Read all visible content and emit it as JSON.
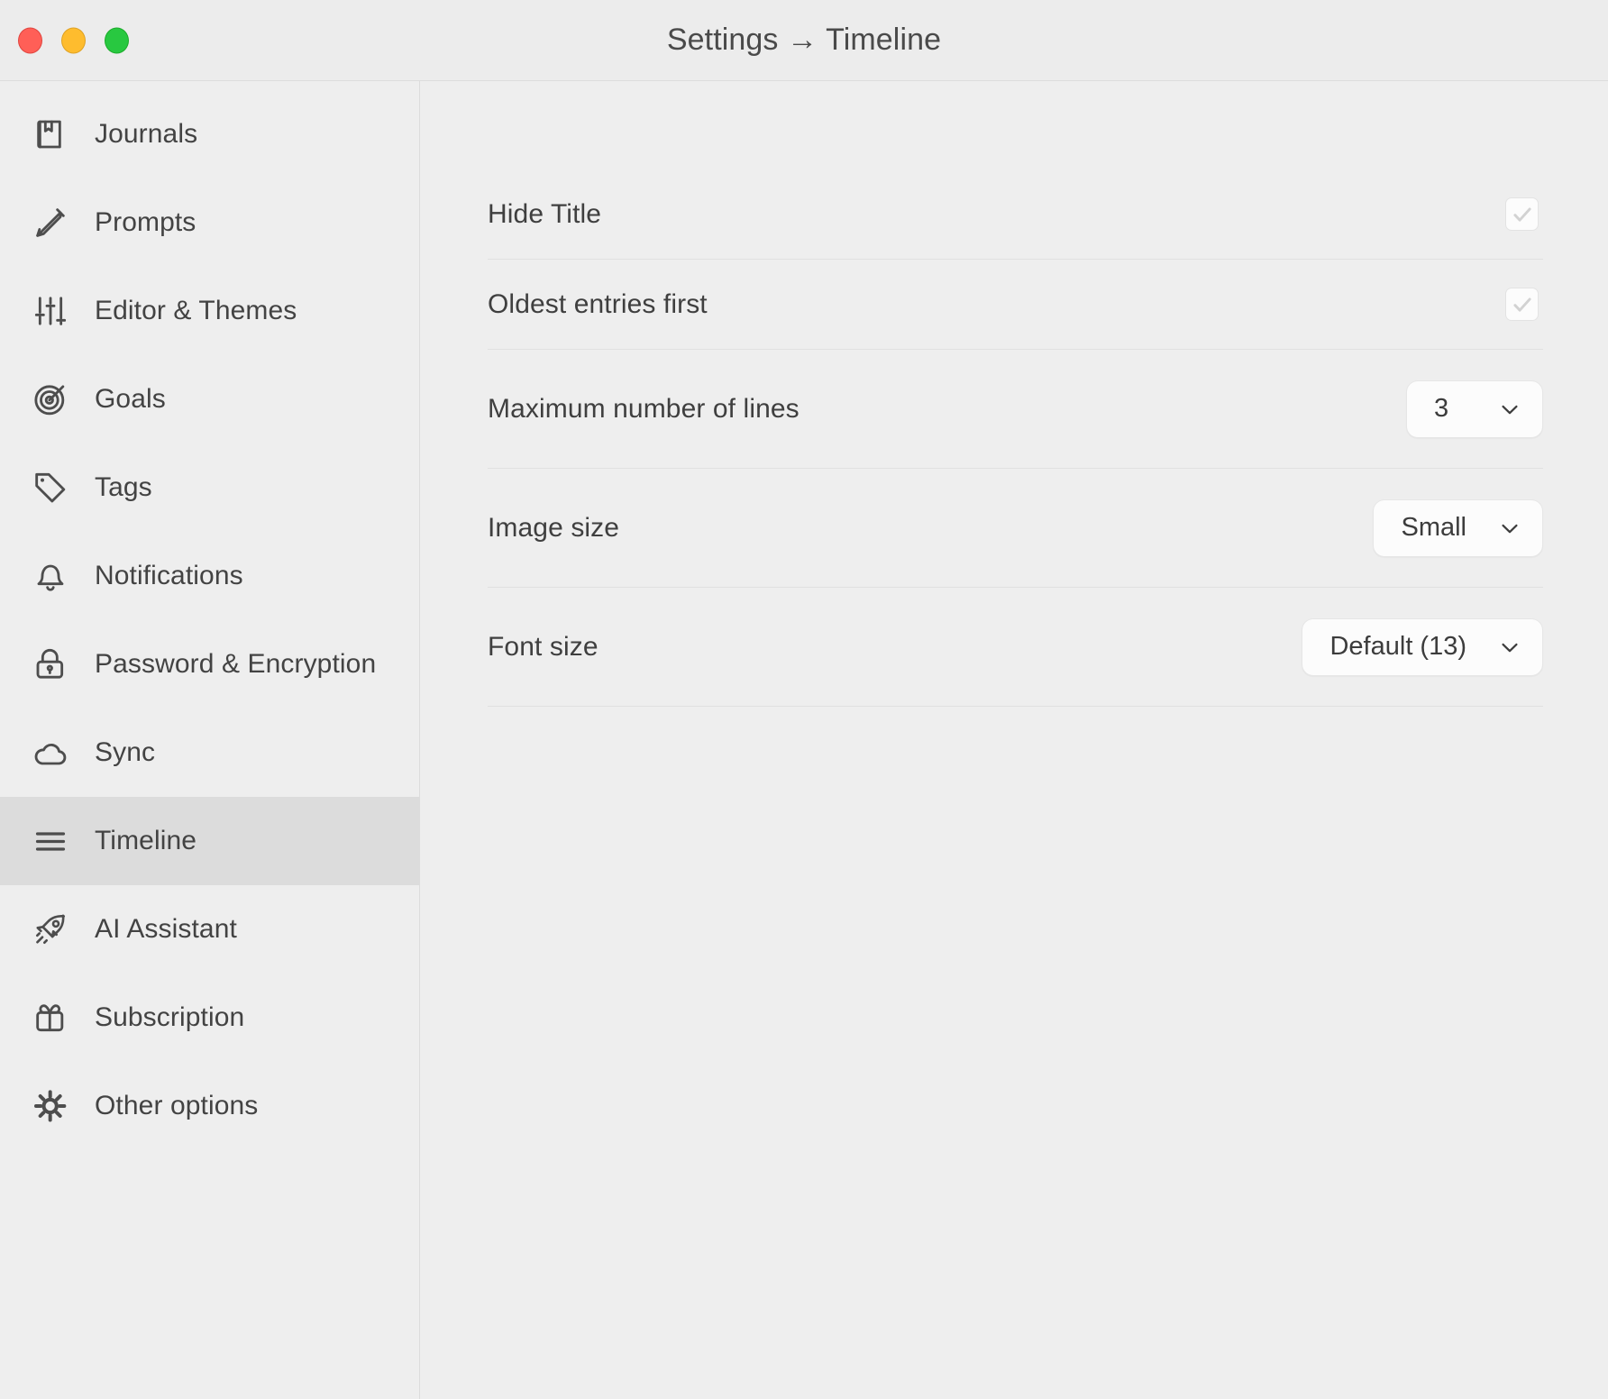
{
  "window": {
    "title": "Settings → Timeline",
    "traffic_lights": {
      "close": "close",
      "minimize": "minimize",
      "maximize": "maximize"
    }
  },
  "sidebar": {
    "items": [
      {
        "label": "Journals",
        "icon": "book-icon",
        "selected": false
      },
      {
        "label": "Prompts",
        "icon": "pencil-icon",
        "selected": false
      },
      {
        "label": "Editor & Themes",
        "icon": "sliders-icon",
        "selected": false
      },
      {
        "label": "Goals",
        "icon": "target-icon",
        "selected": false
      },
      {
        "label": "Tags",
        "icon": "tag-icon",
        "selected": false
      },
      {
        "label": "Notifications",
        "icon": "bell-icon",
        "selected": false
      },
      {
        "label": "Password & Encryption",
        "icon": "lock-icon",
        "selected": false
      },
      {
        "label": "Sync",
        "icon": "cloud-icon",
        "selected": false
      },
      {
        "label": "Timeline",
        "icon": "hamburger-icon",
        "selected": true
      },
      {
        "label": "AI Assistant",
        "icon": "rocket-icon",
        "selected": false
      },
      {
        "label": "Subscription",
        "icon": "gift-icon",
        "selected": false
      },
      {
        "label": "Other options",
        "icon": "gear-icon",
        "selected": false
      }
    ]
  },
  "main": {
    "settings": [
      {
        "label": "Hide Title",
        "control": "checkbox",
        "checked": true
      },
      {
        "label": "Oldest entries first",
        "control": "checkbox",
        "checked": true
      },
      {
        "label": "Maximum number of lines",
        "control": "dropdown",
        "value": "3"
      },
      {
        "label": "Image size",
        "control": "dropdown",
        "value": "Small"
      },
      {
        "label": "Font size",
        "control": "dropdown",
        "value": "Default (13)"
      }
    ]
  },
  "colors": {
    "window_background": "#eeeeee",
    "titlebar_background": "#ececec",
    "selected_item_background": "#dcdcdc",
    "separator": "#e0e0e0",
    "text_primary": "#3f3f3f",
    "icon_stroke": "#4d4d4d",
    "control_background": "#fcfcfc",
    "checkmark": "#d2d2d2",
    "traffic_close": "#ff5f57",
    "traffic_minimize": "#febc2e",
    "traffic_maximize": "#28c840"
  }
}
